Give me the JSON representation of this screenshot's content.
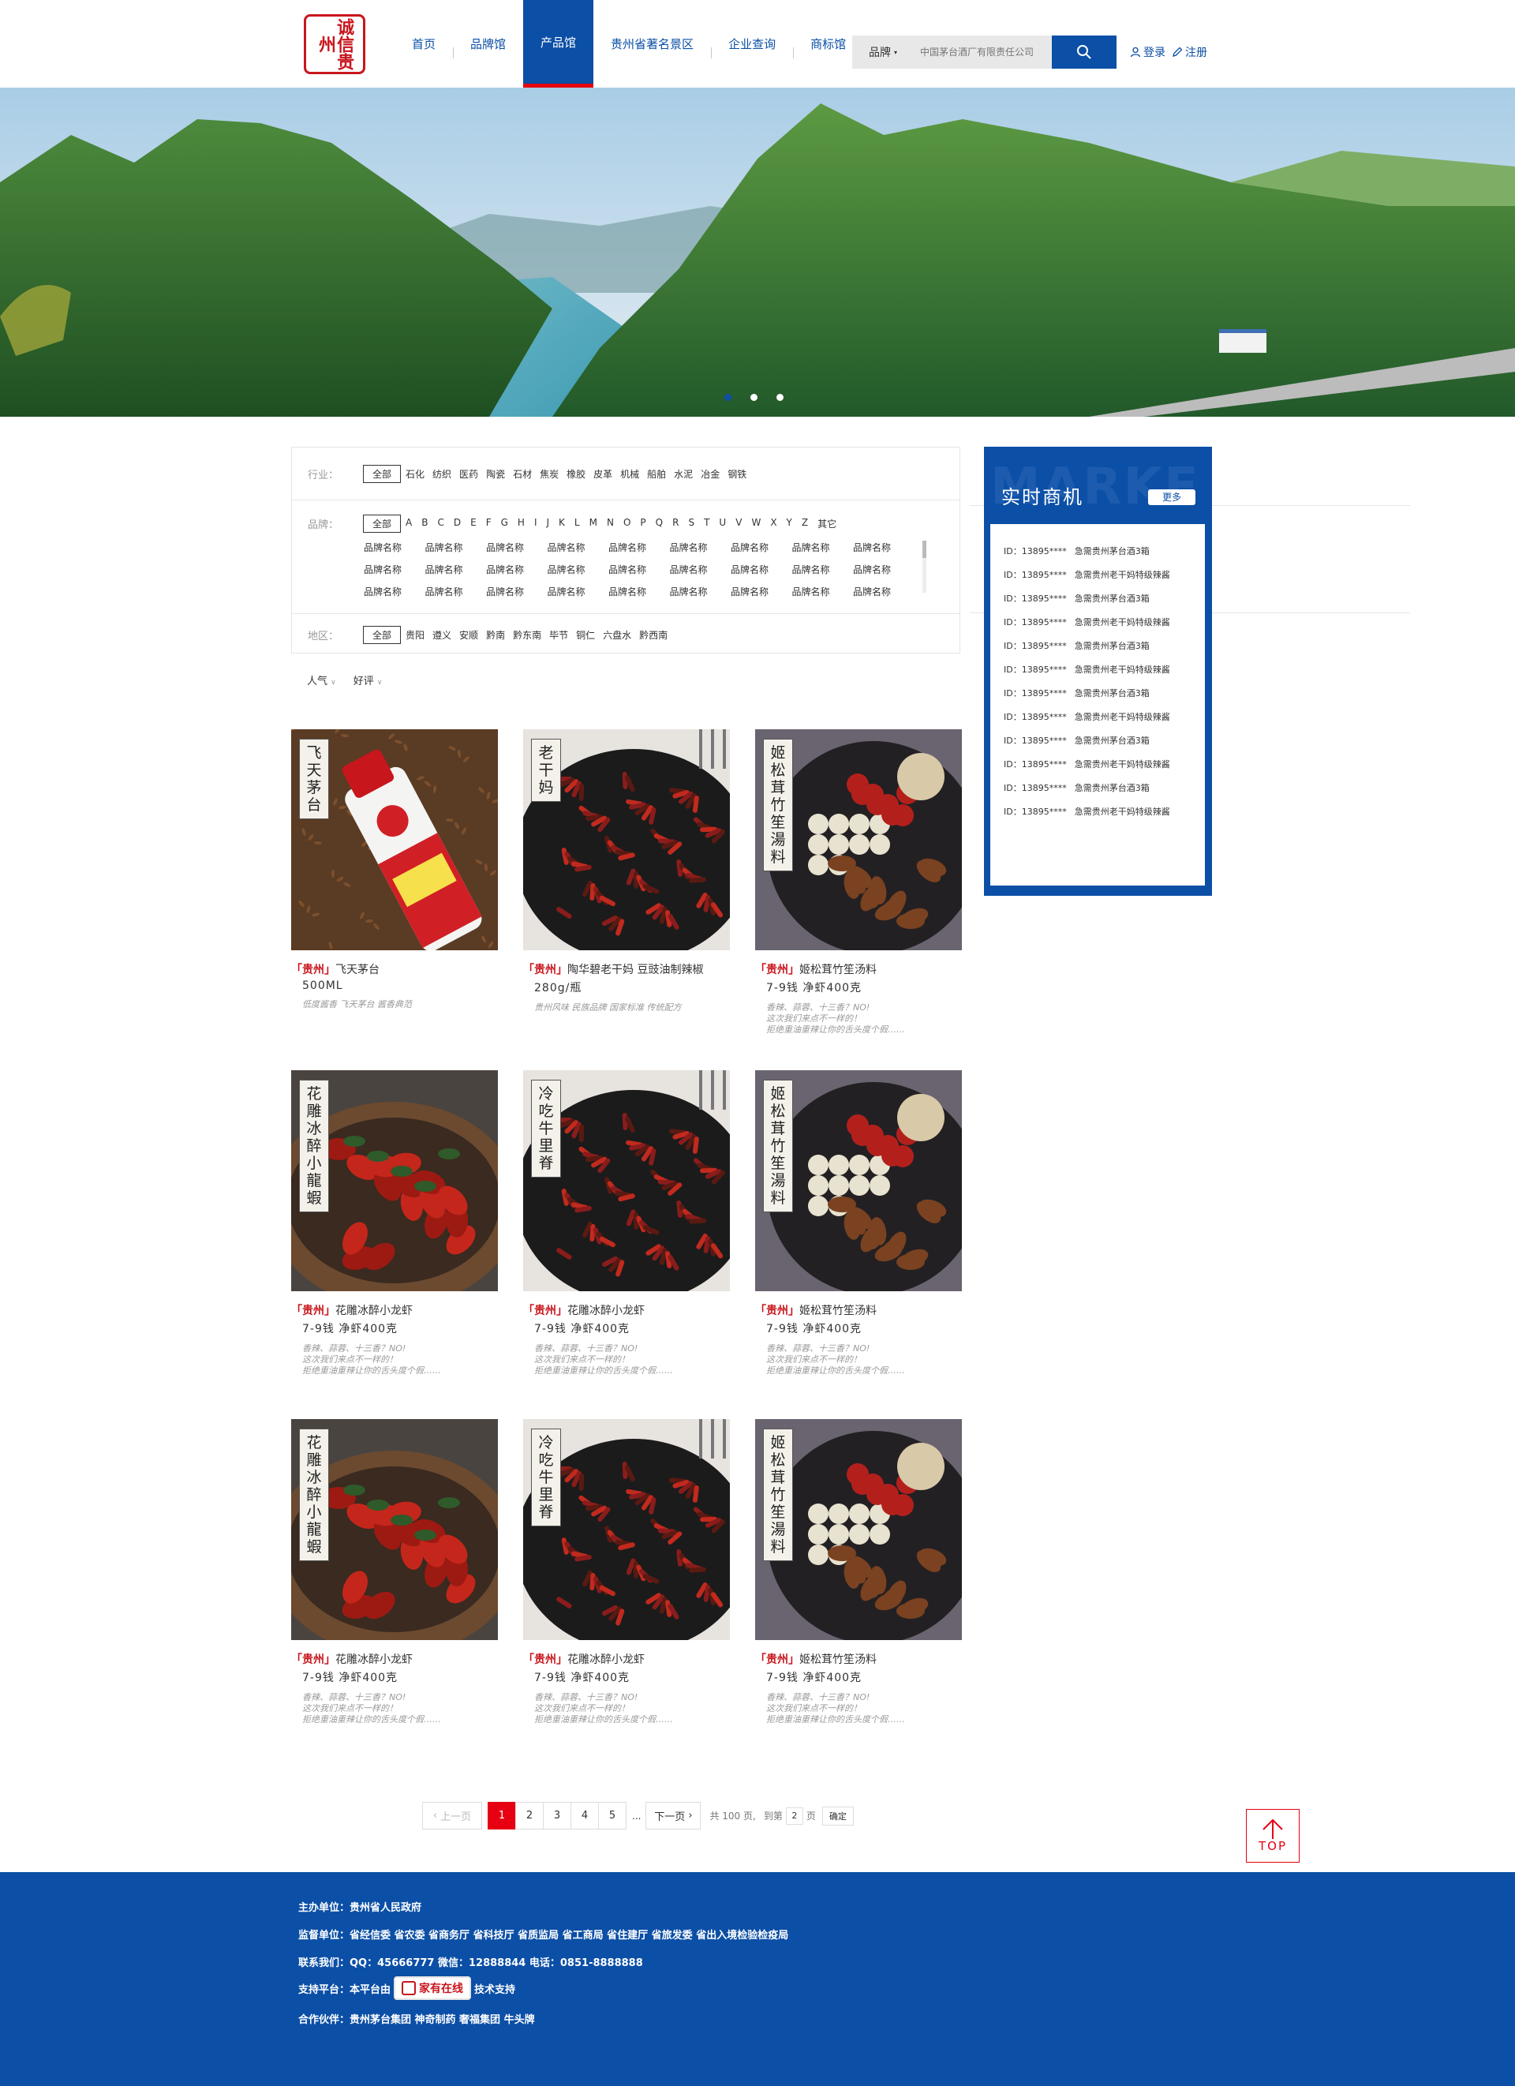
{
  "header": {
    "logo_text": "诚信贵州",
    "nav": [
      {
        "label": "首页",
        "active": false
      },
      {
        "label": "品牌馆",
        "active": false
      },
      {
        "label": "产品馆",
        "active": true
      },
      {
        "label": "贵州省著名景区",
        "active": false
      },
      {
        "label": "企业查询",
        "active": false
      },
      {
        "label": "商标馆",
        "active": false
      }
    ],
    "search": {
      "type": "品牌",
      "placeholder": "中国茅台酒厂有限责任公司"
    },
    "login": "登录",
    "register": "注册"
  },
  "banner": {
    "dots": 3,
    "active_dot": 0
  },
  "filter": {
    "industry_label": "行业：",
    "all": "全部",
    "industries": [
      "石化",
      "纺织",
      "医药",
      "陶瓷",
      "石材",
      "焦炭",
      "橡胶",
      "皮革",
      "机械",
      "船舶",
      "水泥",
      "冶金",
      "钢铁"
    ],
    "brand_label": "品牌：",
    "letters": [
      "A",
      "B",
      "C",
      "D",
      "E",
      "F",
      "G",
      "H",
      "I",
      "J",
      "K",
      "L",
      "M",
      "N",
      "O",
      "P",
      "Q",
      "R",
      "S",
      "T",
      "U",
      "V",
      "W",
      "X",
      "Y",
      "Z",
      "其它"
    ],
    "brand_names": [
      "品牌名称",
      "品牌名称",
      "品牌名称",
      "品牌名称",
      "品牌名称",
      "品牌名称",
      "品牌名称",
      "品牌名称",
      "品牌名称",
      "品牌名称",
      "品牌名称",
      "品牌名称",
      "品牌名称",
      "品牌名称",
      "品牌名称",
      "品牌名称",
      "品牌名称",
      "品牌名称",
      "品牌名称",
      "品牌名称",
      "品牌名称",
      "品牌名称",
      "品牌名称",
      "品牌名称",
      "品牌名称",
      "品牌名称",
      "品牌名称"
    ],
    "region_label": "地区：",
    "regions": [
      "贵阳",
      "遵义",
      "安顺",
      "黔南",
      "黔东南",
      "毕节",
      "铜仁",
      "六盘水",
      "黔西南"
    ]
  },
  "sort": {
    "popularity": "人气",
    "rating": "好评"
  },
  "products": [
    {
      "tag": "「贵州」",
      "name": "飞天茅台",
      "spec": "500ML",
      "desc": "低度酱香 飞天茅台 酱香典范",
      "label": "飞天茅台",
      "theme": "moutai"
    },
    {
      "tag": "「贵州」",
      "name": "陶华碧老干妈 豆豉油制辣椒",
      "spec": "280g/瓶",
      "desc": "贵州风味 民族品牌 国家标准 传统配方",
      "label": "老干妈",
      "theme": "chili"
    },
    {
      "tag": "「贵州」",
      "name": "姬松茸竹笙汤料",
      "spec": "7-9钱 净虾400克",
      "desc": "香辣、蒜蓉、十三香？NO!\n这次我们来点不一样的！\n拒绝重油重辣让你的舌头度个假……",
      "label": "姬松茸竹笙湯料",
      "theme": "soup"
    },
    {
      "tag": "「贵州」",
      "name": "花雕冰醉小龙虾",
      "spec": "7-9钱 净虾400克",
      "desc": "香辣、蒜蓉、十三香？NO!\n这次我们来点不一样的！\n拒绝重油重辣让你的舌头度个假……",
      "label": "花雕冰醉小龍蝦",
      "theme": "crayfish"
    },
    {
      "tag": "「贵州」",
      "name": "花雕冰醉小龙虾",
      "spec": "7-9钱 净虾400克",
      "desc": "香辣、蒜蓉、十三香？NO!\n这次我们来点不一样的！\n拒绝重油重辣让你的舌头度个假……",
      "label": "冷吃牛里脊",
      "theme": "chili"
    },
    {
      "tag": "「贵州」",
      "name": "姬松茸竹笙汤料",
      "spec": "7-9钱 净虾400克",
      "desc": "香辣、蒜蓉、十三香？NO!\n这次我们来点不一样的！\n拒绝重油重辣让你的舌头度个假……",
      "label": "姬松茸竹笙湯料",
      "theme": "soup"
    },
    {
      "tag": "「贵州」",
      "name": "花雕冰醉小龙虾",
      "spec": "7-9钱 净虾400克",
      "desc": "香辣、蒜蓉、十三香？NO!\n这次我们来点不一样的！\n拒绝重油重辣让你的舌头度个假……",
      "label": "花雕冰醉小龍蝦",
      "theme": "crayfish"
    },
    {
      "tag": "「贵州」",
      "name": "花雕冰醉小龙虾",
      "spec": "7-9钱 净虾400克",
      "desc": "香辣、蒜蓉、十三香？NO!\n这次我们来点不一样的！\n拒绝重油重辣让你的舌头度个假……",
      "label": "冷吃牛里脊",
      "theme": "chili"
    },
    {
      "tag": "「贵州」",
      "name": "姬松茸竹笙汤料",
      "spec": "7-9钱 净虾400克",
      "desc": "香辣、蒜蓉、十三香？NO!\n这次我们来点不一样的！\n拒绝重油重辣让你的舌头度个假……",
      "label": "姬松茸竹笙湯料",
      "theme": "soup"
    }
  ],
  "market": {
    "watermark": "MARKE",
    "title": "实时商机",
    "more": "更多",
    "items": [
      {
        "id": "ID：13895****",
        "text": "急需贵州茅台酒3箱"
      },
      {
        "id": "ID：13895****",
        "text": "急需贵州老干妈特级辣酱"
      },
      {
        "id": "ID：13895****",
        "text": "急需贵州茅台酒3箱"
      },
      {
        "id": "ID：13895****",
        "text": "急需贵州老干妈特级辣酱"
      },
      {
        "id": "ID：13895****",
        "text": "急需贵州茅台酒3箱"
      },
      {
        "id": "ID：13895****",
        "text": "急需贵州老干妈特级辣酱"
      },
      {
        "id": "ID：13895****",
        "text": "急需贵州茅台酒3箱"
      },
      {
        "id": "ID：13895****",
        "text": "急需贵州老干妈特级辣酱"
      },
      {
        "id": "ID：13895****",
        "text": "急需贵州茅台酒3箱"
      },
      {
        "id": "ID：13895****",
        "text": "急需贵州老干妈特级辣酱"
      },
      {
        "id": "ID：13895****",
        "text": "急需贵州茅台酒3箱"
      },
      {
        "id": "ID：13895****",
        "text": "急需贵州老干妈特级辣酱"
      }
    ]
  },
  "pager": {
    "prev": "上一页",
    "pages": [
      "1",
      "2",
      "3",
      "4",
      "5"
    ],
    "current": "1",
    "ellipsis": "...",
    "next": "下一页",
    "total": "共 100 页,",
    "goto": "到第",
    "page_value": "2",
    "page_unit": "页",
    "confirm": "确定"
  },
  "top_button": "TOP",
  "footer": {
    "host": "主办单位：贵州省人民政府",
    "supervisor": "监督单位：省经信委 省农委 省商务厅 省科技厅 省质监局 省工商局 省住建厅 省旅发委 省出入境检验检疫局",
    "contact": "联系我们：QQ：45666777 微信：12888844 电话：0851-8888888",
    "support_prefix": "支持平台：本平台由",
    "support_logo": "家有在线",
    "support_suffix": "技术支持",
    "partners": "合作伙伴：贵州茅台集团 神奇制药 奢福集团 牛头牌"
  },
  "colors": {
    "brand_blue": "#0b4fa6",
    "accent_red": "#e60012",
    "tag_red": "#c8161d"
  }
}
